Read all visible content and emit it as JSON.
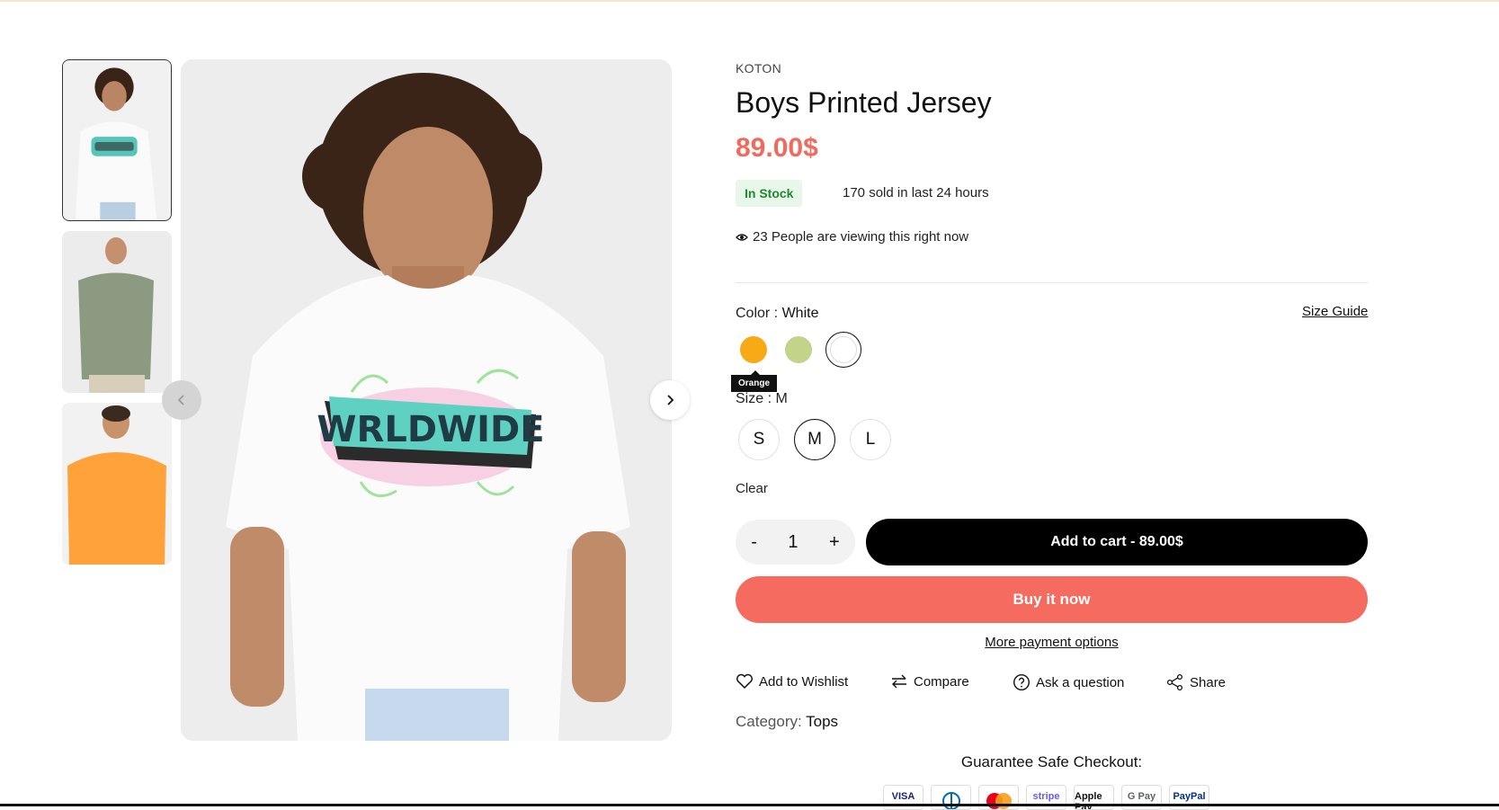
{
  "product": {
    "brand": "KOTON",
    "title": "Boys Printed Jersey",
    "price": "89.00$",
    "stock_badge": "In Stock",
    "sold_text": "170 sold in last 24 hours",
    "viewing_text": "23 People are viewing this right now"
  },
  "color": {
    "label": "Color :",
    "selected": "White",
    "size_guide": "Size Guide",
    "tooltip": "Orange",
    "swatches": [
      {
        "name": "Orange",
        "hex": "#f7a916"
      },
      {
        "name": "Green",
        "hex": "#c3d48a"
      },
      {
        "name": "White",
        "hex": "#ffffff"
      }
    ]
  },
  "size": {
    "label": "Size :",
    "selected": "M",
    "options": [
      "S",
      "M",
      "L"
    ],
    "clear": "Clear"
  },
  "cart": {
    "minus": "-",
    "quantity": "1",
    "plus": "+",
    "add_to_cart": "Add to cart - 89.00$",
    "buy_now": "Buy it now",
    "more_payment": "More payment options"
  },
  "actions": {
    "wishlist": "Add to Wishlist",
    "compare": "Compare",
    "ask": "Ask a question",
    "share": "Share"
  },
  "category": {
    "label": "Category:",
    "value": "Tops"
  },
  "checkout": {
    "title": "Guarantee Safe Checkout:",
    "methods": [
      "VISA",
      "Diners",
      "Mastercard",
      "stripe",
      "Apple Pay",
      "G Pay",
      "PayPal"
    ]
  },
  "graphic": {
    "print_text": "WRLDWIDE"
  },
  "colors": {
    "accent": "#f06a5e",
    "buy_button": "#f56b5f",
    "stock_green": "#1e8a2e"
  }
}
